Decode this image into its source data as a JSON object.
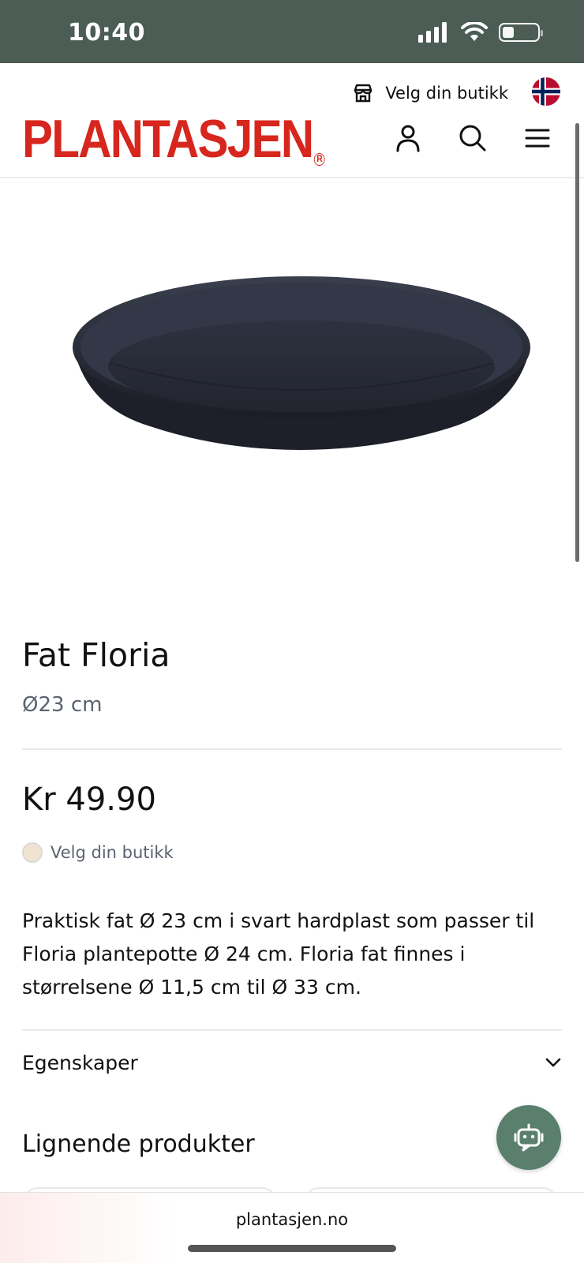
{
  "status_bar": {
    "time": "10:40"
  },
  "header": {
    "store_label": "Velg din butikk",
    "logo_text": "PLANTASJEN",
    "icons": [
      "store-icon",
      "norway-flag-icon",
      "user-icon",
      "search-icon",
      "menu-icon"
    ]
  },
  "product": {
    "title": "Fat Floria",
    "size": "Ø23 cm",
    "price": "Kr 49.90",
    "store_select": "Velg din butikk",
    "description": "Praktisk fat Ø 23 cm i svart hardplast som passer til Floria plantepotte Ø 24 cm. Floria fat finnes i størrelsene Ø 11,5 cm til Ø 33 cm.",
    "image_color": "#22252e"
  },
  "accordion": {
    "label": "Egenskaper"
  },
  "related": {
    "heading": "Lignende produkter"
  },
  "browser": {
    "url": "plantasjen.no"
  },
  "colors": {
    "status_bar": "#4b5d55",
    "brand_red": "#d7261d",
    "chat_button": "#5a7f6d"
  }
}
